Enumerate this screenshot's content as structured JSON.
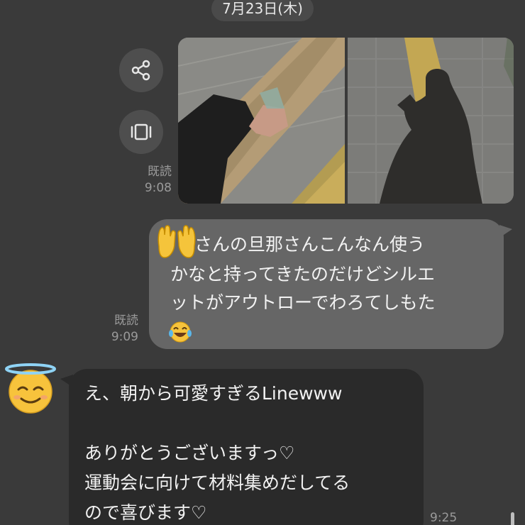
{
  "date_label": "7月23日(木)",
  "actions": {
    "share_icon": "share-icon",
    "preview_icon": "preview-icon"
  },
  "photo_message": {
    "read_label": "既読",
    "time": "9:08"
  },
  "outgoing_message": {
    "read_label": "既読",
    "time": "9:09",
    "line1": "さんの旦那さんこんなん使う",
    "line2": "かなと持ってきたのだけどシルエ",
    "line3": "ットがアウトローでわろてしもた"
  },
  "incoming_message": {
    "line1": "え、朝から可愛すぎるLinewww",
    "line2": "",
    "line3": "ありがとうございますっ♡",
    "line4": "運動会に向けて材料集めだしてる",
    "line5": "ので喜びます♡",
    "time": "9:25"
  }
}
